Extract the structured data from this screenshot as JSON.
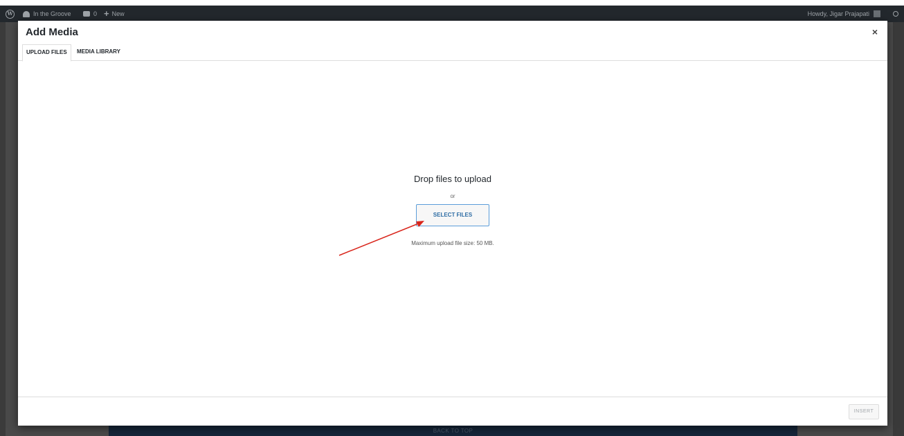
{
  "admin_bar": {
    "site_name": "In the Groove",
    "comment_count": "0",
    "new_label": "New",
    "howdy": "Howdy, Jigar Prajapati"
  },
  "modal": {
    "title": "Add Media",
    "close_icon": "close-icon",
    "tabs": [
      {
        "label": "UPLOAD FILES",
        "active": true
      },
      {
        "label": "MEDIA LIBRARY",
        "active": false
      }
    ],
    "drop_title": "Drop files to upload",
    "or_text": "or",
    "select_button": "SELECT FILES",
    "max_size": "Maximum upload file size: 50 MB.",
    "insert_button": "INSERT"
  },
  "footer": {
    "back_to_top": "BACK TO TOP"
  },
  "colors": {
    "admin_bar": "#23282d",
    "backdrop": "#4a4a4a",
    "button_text": "#2e6da4",
    "annotation_arrow": "#d9261c"
  }
}
